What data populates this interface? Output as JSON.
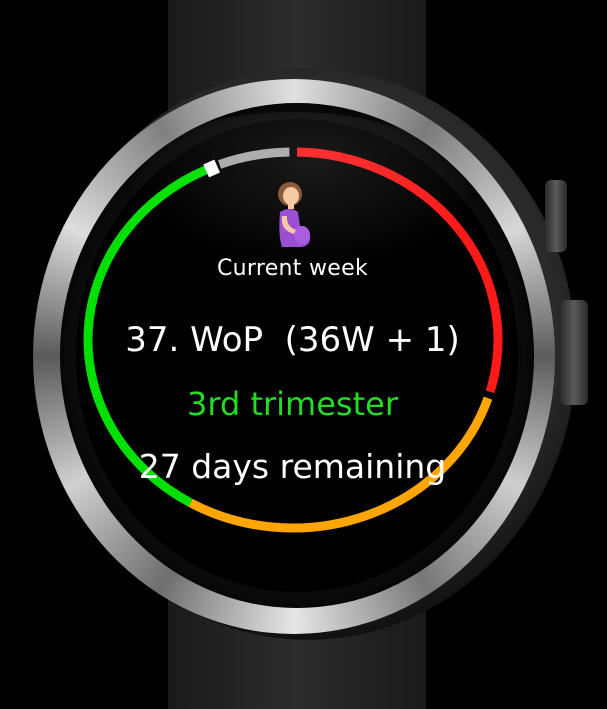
{
  "watchface": {
    "heading": "Current week",
    "week_text": "37. WoP  (36W + 1)",
    "trimester_text": "3rd trimester",
    "remaining_text": "27 days remaining",
    "icon": "pregnant-woman-icon"
  },
  "progress_ring": {
    "segments": [
      {
        "name": "first-trimester",
        "color": "#00e000"
      },
      {
        "name": "second-trimester",
        "color": "#ffa500"
      },
      {
        "name": "third-trimester",
        "color": "#ff1a1a"
      },
      {
        "name": "remaining",
        "color": "#a8a8a8"
      }
    ],
    "progress_fraction": 0.9
  },
  "colors": {
    "text": "#ffffff",
    "trimester_text": "#22dd22",
    "background": "#000000"
  }
}
